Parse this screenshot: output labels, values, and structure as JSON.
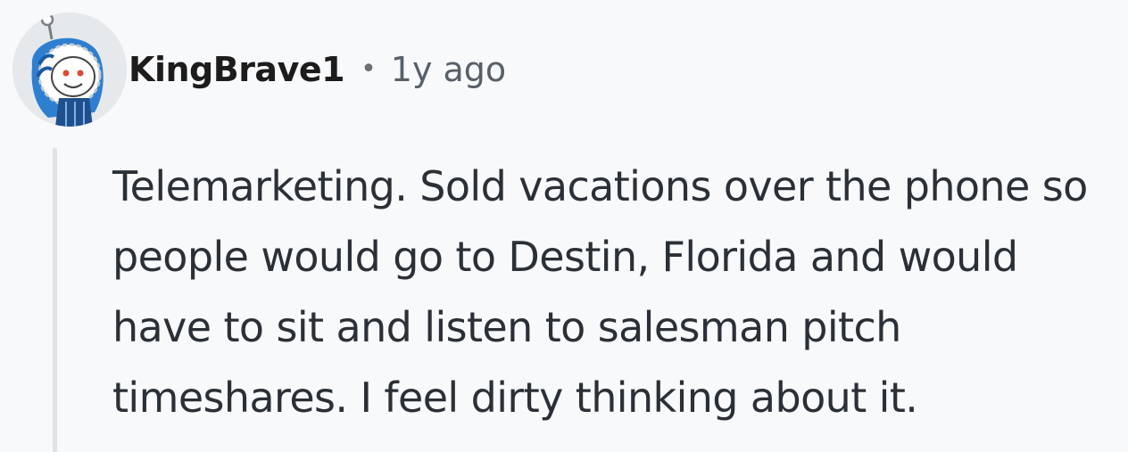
{
  "comment": {
    "author": "KingBrave1",
    "separator": "•",
    "timestamp": "1y ago",
    "avatar_icon": "snoo-avatar-icon",
    "body": "Telemarketing. Sold vacations over the phone so people would go to Destin, Florida and would have to sit and listen to salesman pitch timeshares. I feel dirty thinking about it."
  },
  "colors": {
    "background": "#f7f9fb",
    "text": "#2a3036",
    "meta": "#576068",
    "thread_line": "#dfe3e7",
    "avatar_accent": "#2f7fd1"
  }
}
